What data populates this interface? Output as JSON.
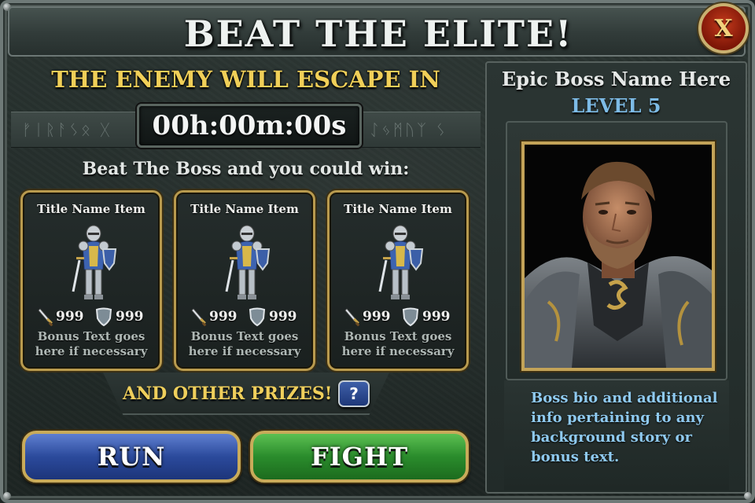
{
  "title": "BEAT THE ELITE!",
  "close_label": "X",
  "escape": {
    "label": "THE ENEMY WILL ESCAPE IN",
    "timer": "00h:00m:00s"
  },
  "rewards": {
    "label": "Beat The Boss and you could win:",
    "items": [
      {
        "title": "Title Name Item",
        "attack": "999",
        "defense": "999",
        "bonus": "Bonus Text goes here if necessary"
      },
      {
        "title": "Title Name Item",
        "attack": "999",
        "defense": "999",
        "bonus": "Bonus Text goes here if necessary"
      },
      {
        "title": "Title Name Item",
        "attack": "999",
        "defense": "999",
        "bonus": "Bonus Text goes here if necessary"
      }
    ],
    "other_prizes_label": "AND OTHER PRIZES!",
    "help_label": "?"
  },
  "actions": {
    "run_label": "RUN",
    "fight_label": "FIGHT"
  },
  "boss": {
    "name": "Epic Boss Name Here",
    "level": "LEVEL 5",
    "bio": "Boss bio and additional\ninfo pertaining to any\nbackground story or\nbonus text."
  },
  "icons": {
    "close": "close-icon",
    "attack": "sword-icon",
    "defense": "shield-icon",
    "help": "help-icon"
  },
  "colors": {
    "gold_text": "#f0cf58",
    "blue_text": "#7dbbe6",
    "run_button": "#2b4a9c",
    "fight_button": "#2a8c2c",
    "close_button": "#a4250f"
  }
}
